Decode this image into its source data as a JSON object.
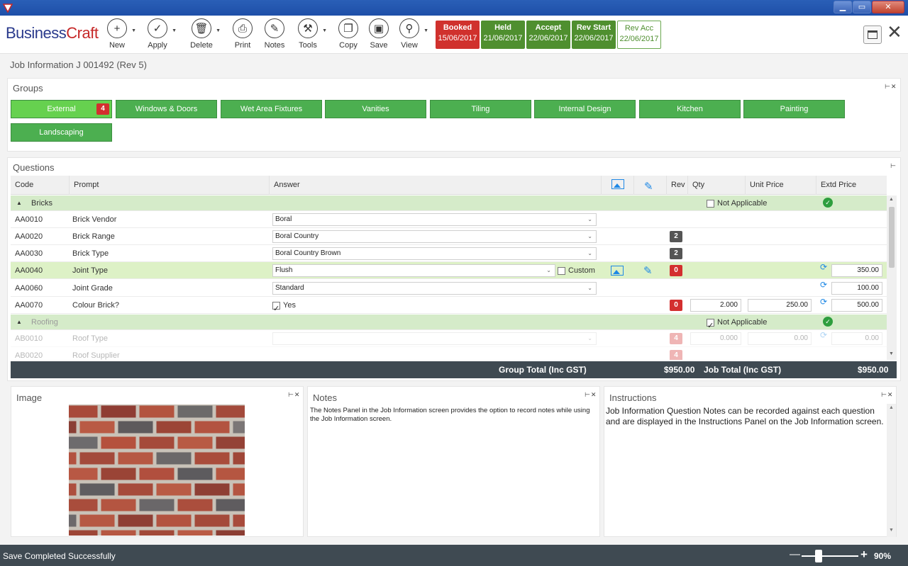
{
  "toolbar": {
    "logo_a": "Business",
    "logo_b": "Craft",
    "buttons": {
      "new": "New",
      "apply": "Apply",
      "delete": "Delete",
      "print": "Print",
      "notes": "Notes",
      "tools": "Tools",
      "copy": "Copy",
      "save": "Save",
      "view": "View"
    },
    "statuses": [
      {
        "label": "Booked",
        "date": "15/06/2017"
      },
      {
        "label": "Held",
        "date": "21/06/2017"
      },
      {
        "label": "Accept",
        "date": "22/06/2017"
      },
      {
        "label": "Rev Start",
        "date": "22/06/2017"
      },
      {
        "label": "Rev Acc",
        "date": "22/06/2017"
      }
    ]
  },
  "page_title": "Job Information J 001492 (Rev 5)",
  "groups": {
    "title": "Groups",
    "active_badge": "4",
    "items": [
      "External",
      "Windows & Doors",
      "Wet Area Fixtures",
      "Vanities",
      "Tiling",
      "Internal Design",
      "Kitchen",
      "Painting",
      "Landscaping"
    ]
  },
  "questions": {
    "title": "Questions",
    "headers": {
      "code": "Code",
      "prompt": "Prompt",
      "answer": "Answer",
      "rev": "Rev",
      "qty": "Qty",
      "unit_price": "Unit Price",
      "extd_price": "Extd Price"
    },
    "not_applicable": "Not Applicable",
    "custom": "Custom",
    "groups": [
      {
        "name": "Bricks"
      },
      {
        "name": "Roofing"
      }
    ],
    "rows": [
      {
        "code": "AA0010",
        "prompt": "Brick Vendor",
        "answer": "Boral"
      },
      {
        "code": "AA0020",
        "prompt": "Brick Range",
        "answer": "Boral Country",
        "rev": "2"
      },
      {
        "code": "AA0030",
        "prompt": "Brick Type",
        "answer": "Boral Country Brown",
        "rev": "2"
      },
      {
        "code": "AA0040",
        "prompt": "Joint Type",
        "answer": "Flush",
        "rev": "0",
        "extd": "350.00"
      },
      {
        "code": "AA0060",
        "prompt": "Joint Grade",
        "answer": "Standard",
        "extd": "100.00"
      },
      {
        "code": "AA0070",
        "prompt": "Colour Brick?",
        "answer": "Yes",
        "rev": "0",
        "qty": "2.000",
        "unit": "250.00",
        "extd": "500.00"
      },
      {
        "code": "AB0010",
        "prompt": "Roof Type",
        "answer": "",
        "rev": "4",
        "qty": "0.000",
        "unit": "0.00",
        "extd": "0.00"
      },
      {
        "code": "AB0020",
        "prompt": "Roof Supplier",
        "answer": "",
        "rev": "4"
      }
    ],
    "totals": {
      "group_label": "Group Total (Inc GST)",
      "group_value": "$950.00",
      "job_label": "Job Total (Inc GST)",
      "job_value": "$950.00"
    }
  },
  "image_panel": {
    "title": "Image"
  },
  "notes_panel": {
    "title": "Notes",
    "text": "The Notes Panel in the Job Information screen provides the option to record notes while using the Job Information screen."
  },
  "instructions_panel": {
    "title": "Instructions",
    "text": "Job Information Question Notes can be recorded against each question and are displayed in the Instructions Panel on the Job Information screen."
  },
  "statusbar": {
    "message": "Save Completed Successfully",
    "zoom": "90%"
  },
  "colors": {
    "green": "#4caf50",
    "red": "#d32f2f",
    "dark": "#3f4a52"
  }
}
